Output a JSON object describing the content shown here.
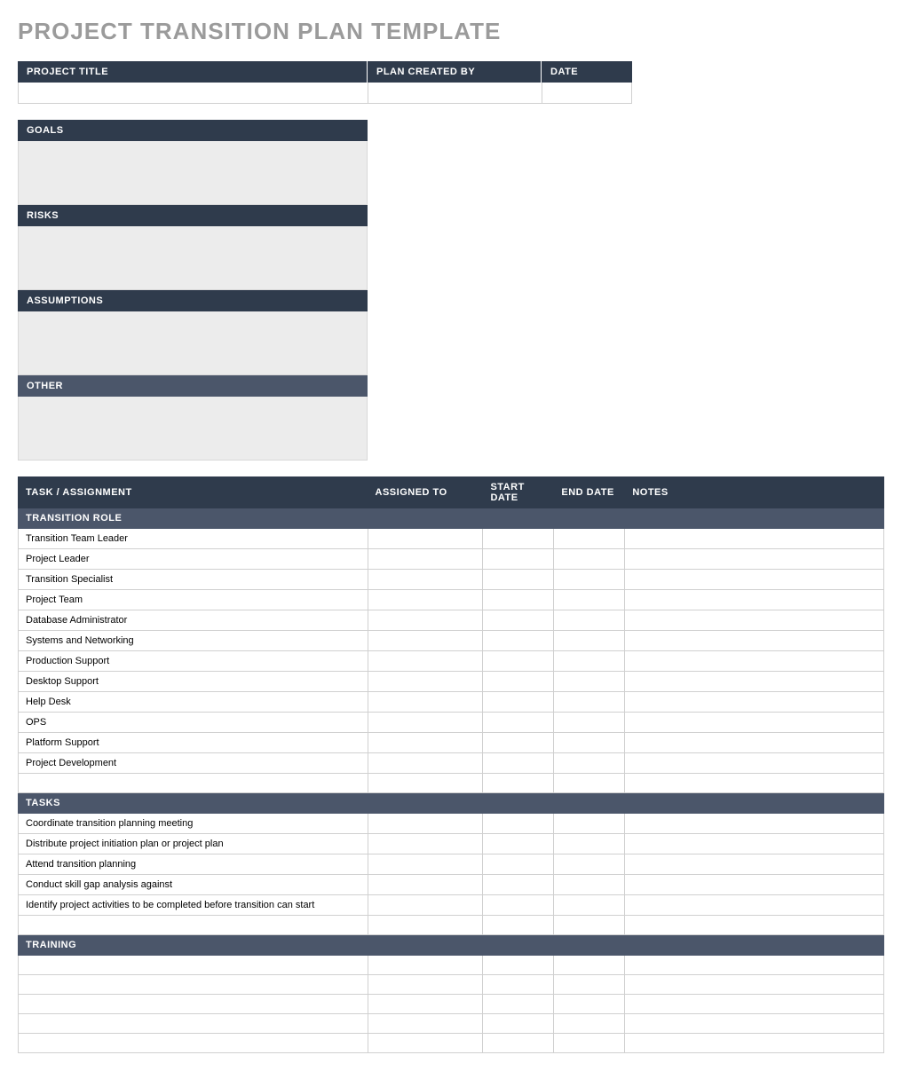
{
  "title": "PROJECT TRANSITION PLAN TEMPLATE",
  "header": {
    "projectTitleLabel": "PROJECT TITLE",
    "planCreatedByLabel": "PLAN CREATED BY",
    "dateLabel": "DATE",
    "projectTitleValue": "",
    "planCreatedByValue": "",
    "dateValue": ""
  },
  "sections": {
    "goals": {
      "label": "GOALS",
      "value": ""
    },
    "risks": {
      "label": "RISKS",
      "value": ""
    },
    "assumptions": {
      "label": "ASSUMPTIONS",
      "value": ""
    },
    "other": {
      "label": "OTHER",
      "value": ""
    }
  },
  "table": {
    "columns": {
      "task": "TASK / ASSIGNMENT",
      "assigned": "ASSIGNED TO",
      "start": "START DATE",
      "end": "END DATE",
      "notes": "NOTES"
    },
    "groups": [
      {
        "label": "TRANSITION ROLE",
        "rows": [
          "Transition Team Leader",
          "Project Leader",
          "Transition Specialist",
          "Project Team",
          "Database Administrator",
          "Systems and Networking",
          "Production Support",
          "Desktop Support",
          "Help Desk",
          "OPS",
          "Platform Support",
          "Project Development",
          ""
        ]
      },
      {
        "label": "TASKS",
        "rows": [
          "Coordinate transition planning meeting",
          "Distribute project initiation plan or project plan",
          "Attend transition planning",
          "Conduct skill gap analysis against",
          "Identify project activities to be completed before transition can start",
          ""
        ]
      },
      {
        "label": "TRAINING",
        "rows": [
          "",
          "",
          "",
          "",
          ""
        ]
      }
    ]
  }
}
